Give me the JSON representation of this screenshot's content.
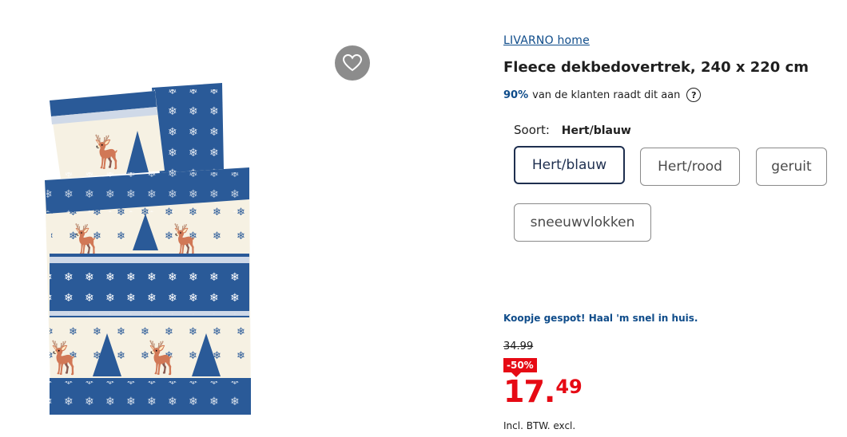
{
  "product": {
    "brand": "LIVARNO home",
    "title": "Fleece dekbedovertrek, 240 x 220 cm",
    "recommend_pct": "90%",
    "recommend_text": "van de klanten raadt dit aan",
    "help_glyph": "?"
  },
  "favorite": {
    "icon": "heart-icon"
  },
  "variants": {
    "label": "Soort:",
    "selected": "Hert/blauw",
    "options": [
      "Hert/blauw",
      "Hert/rood",
      "geruit",
      "sneeuwvlokken"
    ]
  },
  "pricing": {
    "promo_text": "Koopje gespot! Haal 'm snel in huis.",
    "old_price": "34.99",
    "discount": "-50%",
    "price_int": "17.",
    "price_dec": "49",
    "tax_note": "Incl. BTW. excl."
  },
  "colors": {
    "accent_blue": "#0f4c8a",
    "sale_red": "#e60a14",
    "fabric_blue": "#2a5a98",
    "fabric_cream": "#f6f1e3"
  }
}
